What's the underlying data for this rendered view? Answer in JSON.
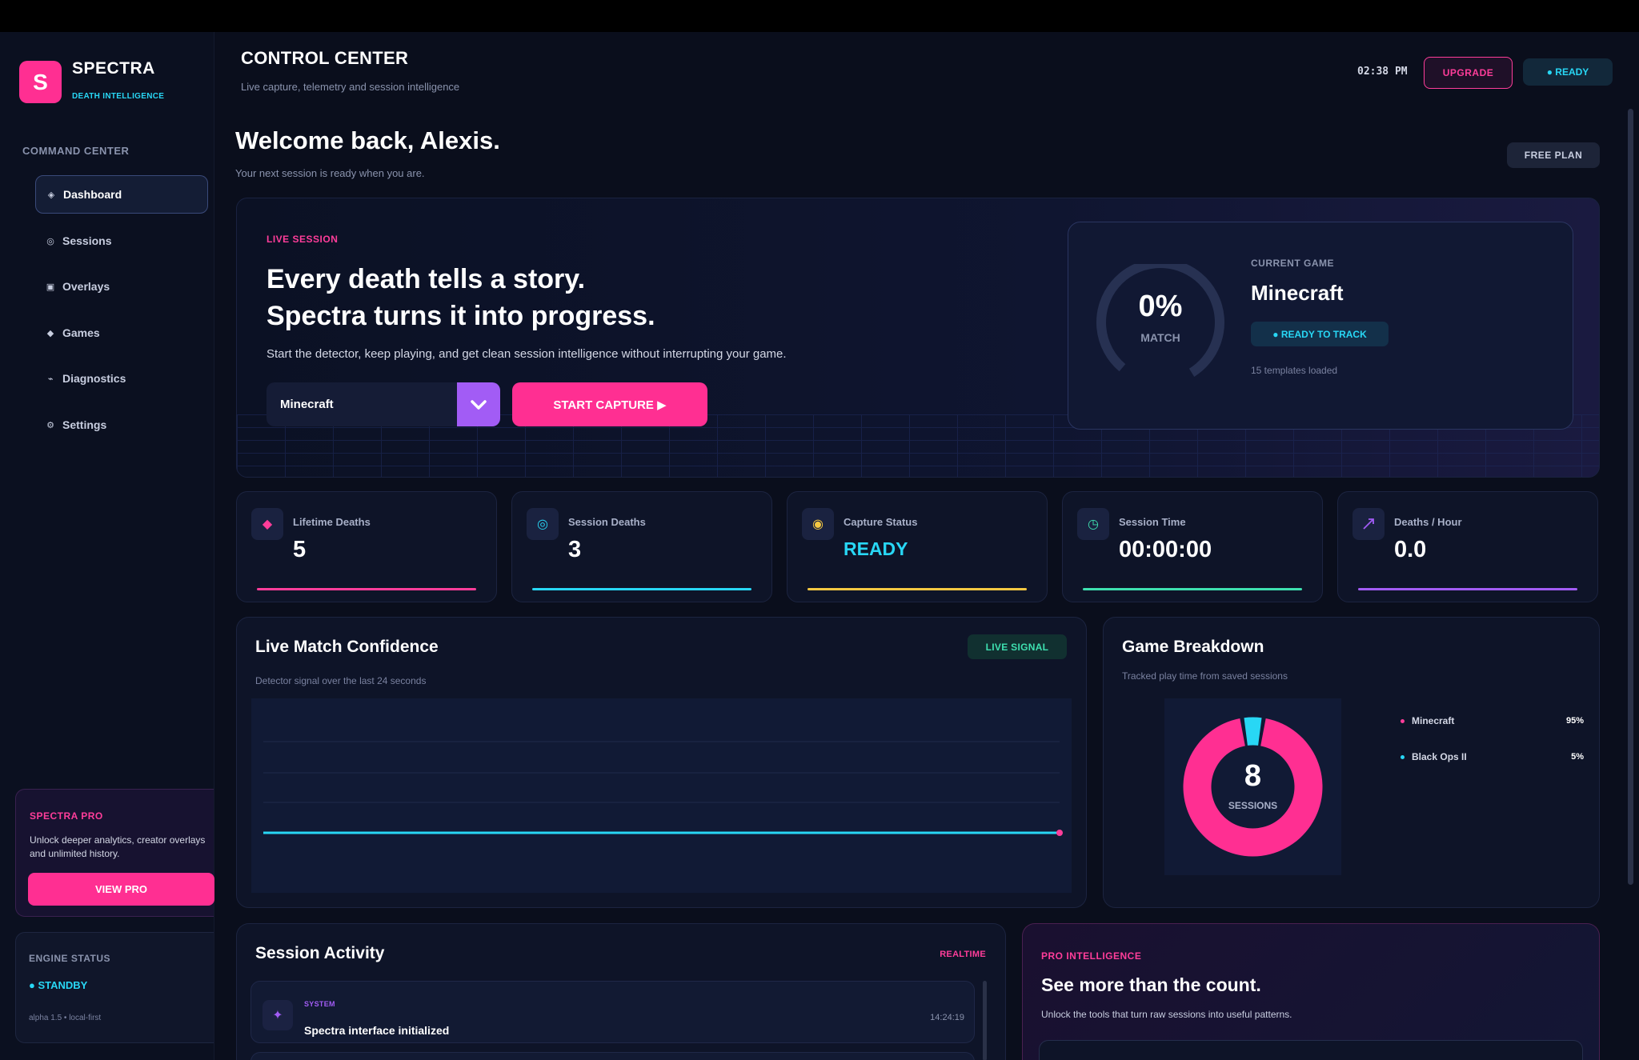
{
  "brand": {
    "logo": "S",
    "name": "SPECTRA",
    "tagline": "DEATH INTELLIGENCE"
  },
  "sidebar": {
    "section": "COMMAND CENTER",
    "items": [
      {
        "label": "Dashboard",
        "icon": "diamond-icon"
      },
      {
        "label": "Sessions",
        "icon": "ring-icon"
      },
      {
        "label": "Overlays",
        "icon": "square-icon"
      },
      {
        "label": "Games",
        "icon": "diamond-small-icon"
      },
      {
        "label": "Diagnostics",
        "icon": "pulse-icon"
      },
      {
        "label": "Settings",
        "icon": "gear-icon"
      }
    ],
    "pro": {
      "title": "SPECTRA PRO",
      "text": "Unlock deeper analytics, creator overlays and unlimited history.",
      "button": "VIEW PRO"
    },
    "engine": {
      "title": "ENGINE STATUS",
      "status": "● STANDBY",
      "version": "alpha 1.5 • local-first"
    }
  },
  "header": {
    "title": "CONTROL CENTER",
    "subtitle": "Live capture, telemetry and session intelligence",
    "clock": "02:38 PM",
    "upgrade": "UPGRADE",
    "ready": "● READY"
  },
  "welcome": {
    "title": "Welcome back, Alexis.",
    "subtitle": "Your next session is ready when you are.",
    "plan": "FREE PLAN"
  },
  "hero": {
    "label": "LIVE SESSION",
    "headline_1": "Every death tells a story.",
    "headline_2": "Spectra turns it into progress.",
    "description": "Start the detector, keep playing, and get clean session intelligence without interrupting your game.",
    "selected_game": "Minecraft",
    "start_button": "START CAPTURE ▶"
  },
  "current_game": {
    "match_pct": "0%",
    "match_label": "MATCH",
    "match_value": 0,
    "label": "CURRENT GAME",
    "game": "Minecraft",
    "status": "● READY TO TRACK",
    "templates": "15 templates loaded"
  },
  "stats": [
    {
      "label": "Lifetime Deaths",
      "value": "5",
      "icon": "diamond-icon",
      "color": "#ff3d9a"
    },
    {
      "label": "Session Deaths",
      "value": "3",
      "icon": "target-icon",
      "color": "#28d7f5"
    },
    {
      "label": "Capture Status",
      "value": "READY",
      "icon": "dot-circle-icon",
      "color": "#f5c842"
    },
    {
      "label": "Session Time",
      "value": "00:00:00",
      "icon": "clock-icon",
      "color": "#3ee0b0"
    },
    {
      "label": "Deaths / Hour",
      "value": "0.0",
      "icon": "trend-icon",
      "color": "#a25cf5"
    }
  ],
  "confidence": {
    "title": "Live Match Confidence",
    "subtitle": "Detector signal over the last 24 seconds",
    "badge": "LIVE SIGNAL",
    "chart_data": {
      "type": "line",
      "series": [
        {
          "values": [
            0,
            0
          ]
        }
      ],
      "color": "#28d7f5",
      "grid": true
    }
  },
  "breakdown": {
    "title": "Game Breakdown",
    "subtitle": "Tracked play time from saved sessions",
    "sessions": "8",
    "sessions_label": "SESSIONS",
    "chart_data": {
      "type": "pie",
      "categories": [
        "Minecraft",
        "Black Ops II"
      ],
      "values": [
        95,
        5
      ],
      "labels": [
        "95%",
        "5%"
      ],
      "colors": [
        "#ff2f92",
        "#28d7f5"
      ]
    }
  },
  "activity": {
    "title": "Session Activity",
    "badge": "REALTIME",
    "rows": [
      {
        "tag": "SYSTEM",
        "text": "Spectra interface initialized",
        "time": "14:24:19"
      }
    ]
  },
  "pro_intel": {
    "tag": "PRO INTELLIGENCE",
    "title": "See more than the count.",
    "subtitle": "Unlock the tools that turn raw sessions into useful patterns."
  }
}
